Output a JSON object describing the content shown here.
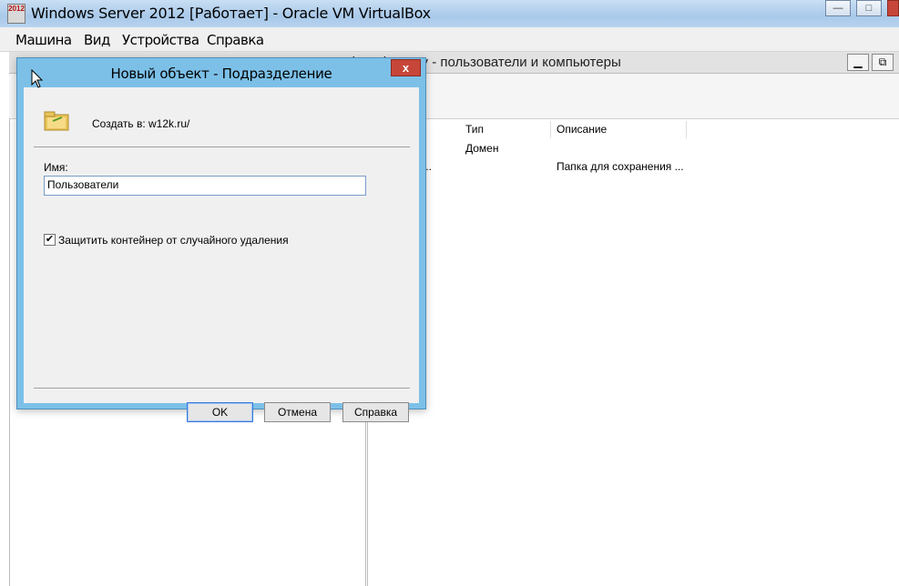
{
  "vbox": {
    "title": "Windows Server 2012 [Работает] - Oracle VM VirtualBox",
    "app_icon_text": "2012",
    "controls": {
      "minimize": "—",
      "maximize": "□",
      "close": "✕"
    },
    "menu": [
      "Машина",
      "Вид",
      "Устройства",
      "Справка"
    ]
  },
  "mmc": {
    "title": "Active Directory - пользователи и компьютеры",
    "columns": [
      "Тип",
      "Описание"
    ],
    "rows": [
      {
        "name": "",
        "type": "Домен",
        "description": ""
      },
      {
        "name": "енн...",
        "type": "",
        "description": "Папка для сохранения ..."
      }
    ]
  },
  "dialog": {
    "title": "Новый объект - Подразделение",
    "close_glyph": "x",
    "create_in_label": "Создать в:",
    "create_in_value": "w12k.ru/",
    "name_label": "Имя:",
    "name_value": "Пользователи",
    "protect_checked": true,
    "protect_label": "Защитить контейнер от случайного удаления",
    "buttons": {
      "ok": "OK",
      "cancel": "Отмена",
      "help": "Справка"
    }
  }
}
